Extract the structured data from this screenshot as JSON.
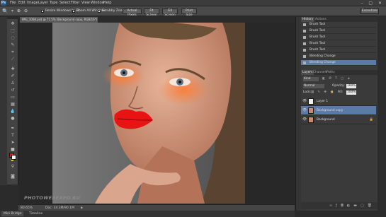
{
  "app": {
    "logo": "Ps",
    "window_controls": "– ▢ ✕"
  },
  "menu": [
    "File",
    "Edit",
    "Image",
    "Layer",
    "Type",
    "Select",
    "Filter",
    "View",
    "Window",
    "Help"
  ],
  "options_bar": {
    "resize_windows": "Resize Windows to Fit",
    "zoom_all": "Zoom All Windows",
    "scrubby_zoom": "Scrubby Zoom",
    "actual_pixels": "Actual Pixels",
    "fit_screen": "Fit Screen",
    "fill_screen": "Fill Screen",
    "print_size": "Print Size",
    "workspace": "Essentials"
  },
  "document": {
    "tab": "IMG_1068.psd @ 71.5% (Background copy, RGB/16*) ×",
    "watermark": "PHOTOWEBEXPO.RU",
    "zoom": "80.65%",
    "doc_size": "Doc: 34.3M/90.1M"
  },
  "bottom_tabs": [
    "Mini Bridge",
    "Timeline"
  ],
  "history": {
    "tabs": [
      "History",
      "Actions"
    ],
    "items": [
      "Brush Tool",
      "Brush Tool",
      "Brush Tool",
      "Brush Tool",
      "Brush Tool",
      "Blending Change",
      "Blending Change"
    ]
  },
  "layers": {
    "tabs": [
      "Layers",
      "Channels",
      "Paths"
    ],
    "kind": "Kind",
    "blend_mode": "Normal",
    "opacity_label": "Opacity:",
    "opacity": "100%",
    "lock_label": "Lock:",
    "fill_label": "Fill:",
    "fill": "100%",
    "items": [
      "Layer 1",
      "Background copy",
      "Background"
    ]
  },
  "colors": {
    "foreground": "#d32020",
    "background": "#ffffff",
    "selection": "#5b7ba6"
  },
  "icons": [
    "zoom-icon",
    "zoom-in-icon",
    "zoom-out-icon",
    "move-tool-icon",
    "marquee-tool-icon",
    "lasso-tool-icon",
    "quick-select-icon",
    "crop-tool-icon",
    "eyedropper-icon",
    "healing-brush-icon",
    "brush-tool-icon",
    "clone-stamp-icon",
    "history-brush-icon",
    "eraser-icon",
    "gradient-icon",
    "blur-icon",
    "dodge-icon",
    "pen-tool-icon",
    "type-tool-icon",
    "path-select-icon",
    "shape-tool-icon",
    "hand-tool-icon",
    "zoom-tool-icon",
    "eye-icon",
    "lock-icon",
    "link-icon",
    "fx-icon",
    "mask-icon",
    "adjustment-icon",
    "folder-icon",
    "new-layer-icon",
    "trash-icon"
  ]
}
